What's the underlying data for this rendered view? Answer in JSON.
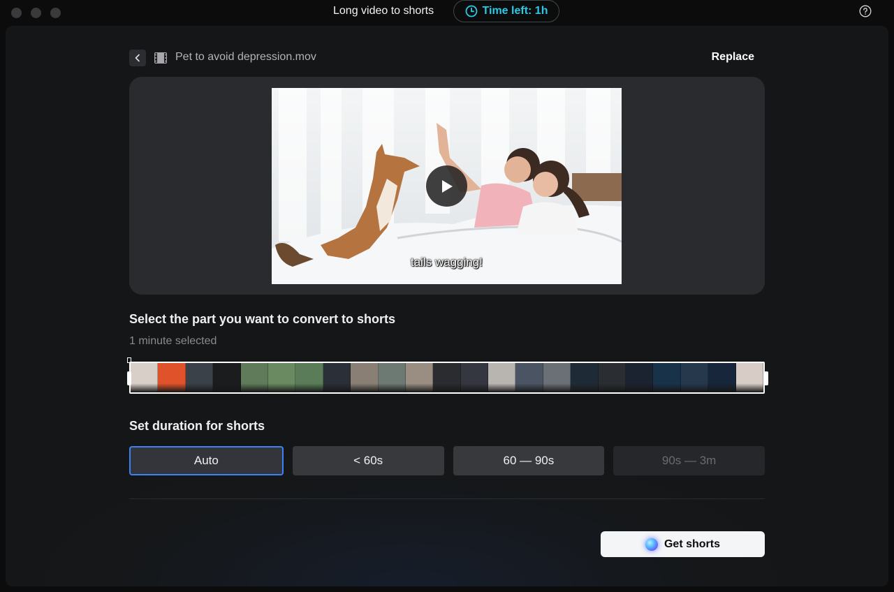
{
  "window": {
    "title": "Long video to shorts",
    "time_left": "Time left: 1h",
    "accent_color": "#2bc9e6"
  },
  "file": {
    "name": "Pet to avoid depression.mov",
    "replace_label": "Replace"
  },
  "preview": {
    "caption": "tails wagging!"
  },
  "selection": {
    "title": "Select the part you want to convert to shorts",
    "status": "1 minute selected",
    "frame_colors": [
      "#d9cfc9",
      "#e0522a",
      "#3a4149",
      "#1b1c1e",
      "#5f7b5a",
      "#6a8a62",
      "#5a7c58",
      "#2a2f38",
      "#8a7f74",
      "#6d7a74",
      "#9a8d82",
      "#2b2c30",
      "#343640",
      "#b8b4b0",
      "#4a5463",
      "#6b6f76",
      "#1e2b36",
      "#2a2e33",
      "#1b2230",
      "#18324a",
      "#26384c",
      "#17263a",
      "#d8cdc6"
    ]
  },
  "duration": {
    "title": "Set duration for shorts",
    "options": [
      {
        "label": "Auto",
        "state": "selected"
      },
      {
        "label": "< 60s",
        "state": "normal"
      },
      {
        "label": "60 — 90s",
        "state": "normal"
      },
      {
        "label": "90s — 3m",
        "state": "disabled"
      }
    ],
    "selected_color": "#3b82f6"
  },
  "action": {
    "get_shorts_label": "Get shorts"
  }
}
